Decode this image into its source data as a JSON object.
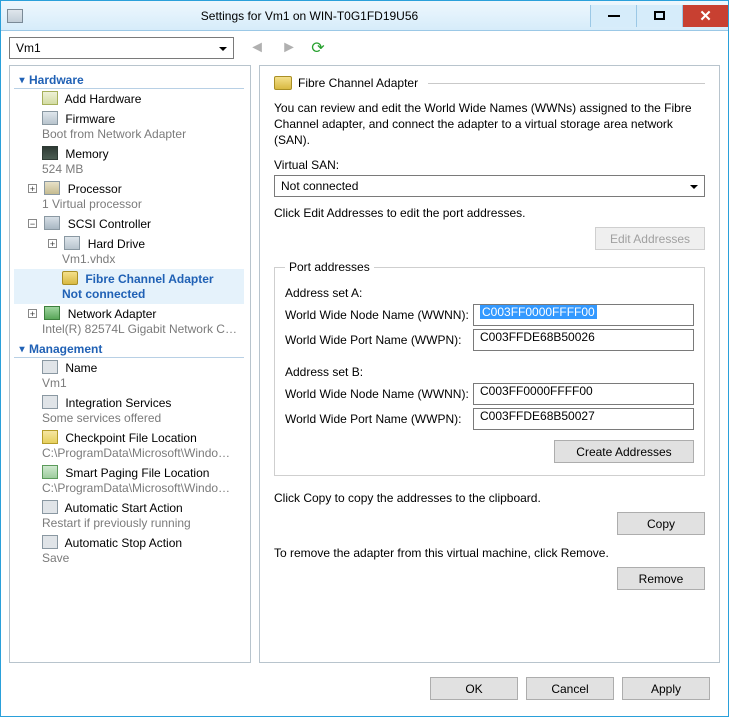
{
  "window": {
    "title": "Settings for Vm1 on WIN-T0G1FD19U56"
  },
  "toolbar": {
    "vm_selected": "Vm1"
  },
  "sections": {
    "hardware": "Hardware",
    "management": "Management"
  },
  "tree": {
    "add_hardware": "Add Hardware",
    "firmware": {
      "label": "Firmware",
      "sub": "Boot from Network Adapter"
    },
    "memory": {
      "label": "Memory",
      "sub": "524 MB"
    },
    "processor": {
      "label": "Processor",
      "sub": "1 Virtual processor"
    },
    "scsi": {
      "label": "SCSI Controller"
    },
    "harddrive": {
      "label": "Hard Drive",
      "sub": "Vm1.vhdx"
    },
    "fc": {
      "label": "Fibre Channel Adapter",
      "sub": "Not connected"
    },
    "net": {
      "label": "Network Adapter",
      "sub": "Intel(R) 82574L Gigabit Network C…"
    },
    "name": {
      "label": "Name",
      "sub": "Vm1"
    },
    "integ": {
      "label": "Integration Services",
      "sub": "Some services offered"
    },
    "chk": {
      "label": "Checkpoint File Location",
      "sub": "C:\\ProgramData\\Microsoft\\Windo…"
    },
    "spf": {
      "label": "Smart Paging File Location",
      "sub": "C:\\ProgramData\\Microsoft\\Windo…"
    },
    "astart": {
      "label": "Automatic Start Action",
      "sub": "Restart if previously running"
    },
    "astop": {
      "label": "Automatic Stop Action",
      "sub": "Save"
    }
  },
  "pane": {
    "title": "Fibre Channel Adapter",
    "desc": "You can review and edit the World Wide Names (WWNs) assigned to the Fibre Channel adapter, and connect the adapter to a virtual storage area network (SAN).",
    "vsan_label": "Virtual SAN:",
    "vsan_value": "Not connected",
    "edit_hint": "Click Edit Addresses to edit the port addresses.",
    "edit_btn": "Edit Addresses",
    "group_title": "Port addresses",
    "set_a": "Address set A:",
    "set_b": "Address set B:",
    "wwnn_label": "World Wide Node Name (WWNN):",
    "wwpn_label": "World Wide Port Name (WWPN):",
    "a_wwnn": "C003FF0000FFFF00",
    "a_wwpn": "C003FFDE68B50026",
    "b_wwnn": "C003FF0000FFFF00",
    "b_wwpn": "C003FFDE68B50027",
    "create_btn": "Create Addresses",
    "copy_hint": "Click Copy to copy the addresses to the clipboard.",
    "copy_btn": "Copy",
    "remove_hint": "To remove the adapter from this virtual machine, click Remove.",
    "remove_btn": "Remove"
  },
  "footer": {
    "ok": "OK",
    "cancel": "Cancel",
    "apply": "Apply"
  }
}
